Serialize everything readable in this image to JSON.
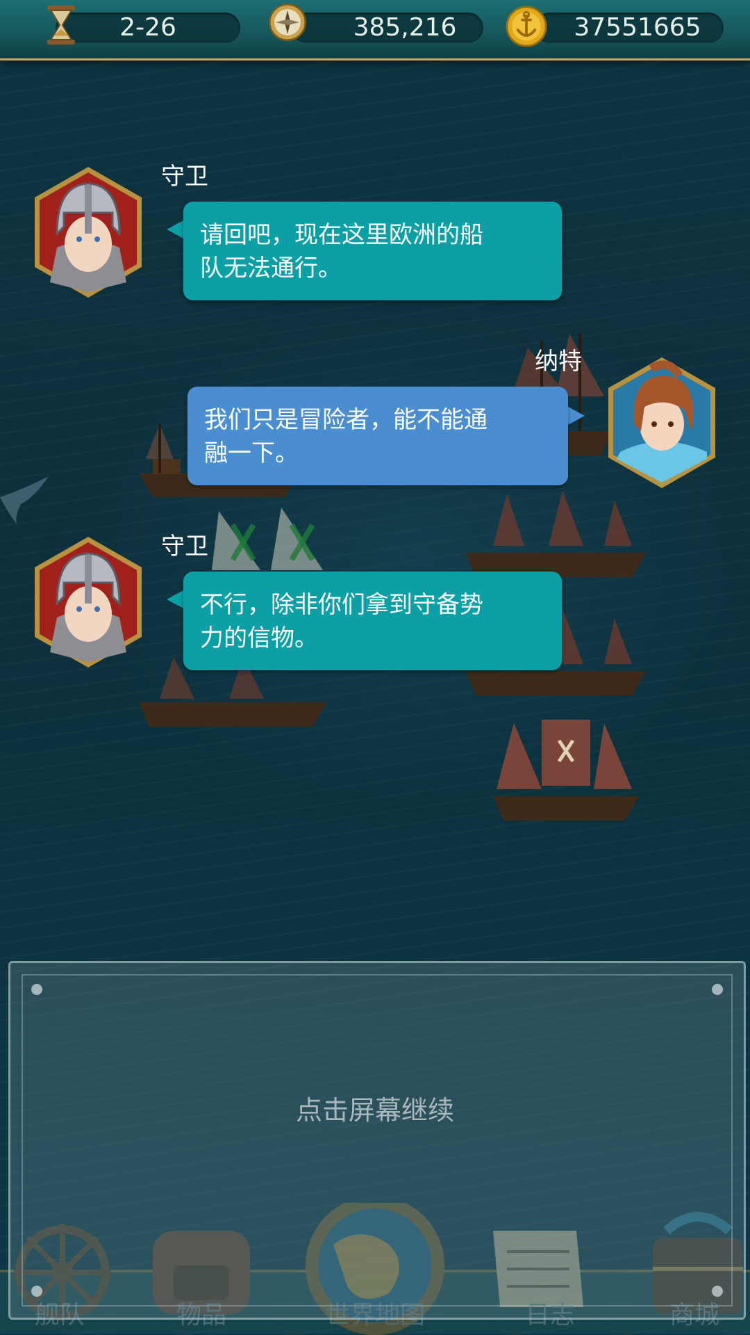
{
  "top_bar": {
    "date": "2-26",
    "compass_value": "385,216",
    "gold": "37551665",
    "icons": [
      "hourglass-icon",
      "compass-icon",
      "anchor-coin-icon"
    ]
  },
  "dialogue": [
    {
      "speaker": "守卫",
      "line1": "请回吧，现在这里欧洲的船",
      "line2": "队无法通行。",
      "side": "left",
      "color": "#0aa0a6"
    },
    {
      "speaker": "纳特",
      "line1": "我们只是冒险者，能不能通",
      "line2": "融一下。",
      "side": "right",
      "color": "#4a8ed1"
    },
    {
      "speaker": "守卫",
      "line1": "不行，除非你们拿到守备势",
      "line2": "力的信物。",
      "side": "left",
      "color": "#0aa0a6"
    }
  ],
  "prompt": "点击屏幕继续",
  "nav": {
    "items": [
      {
        "label": "舰队",
        "icon": "ship-wheel-icon"
      },
      {
        "label": "物品",
        "icon": "backpack-icon"
      },
      {
        "label": "世界地图",
        "icon": "globe-icon"
      },
      {
        "label": "日志",
        "icon": "scroll-icon"
      },
      {
        "label": "商城",
        "icon": "treasure-chest-icon"
      }
    ]
  }
}
